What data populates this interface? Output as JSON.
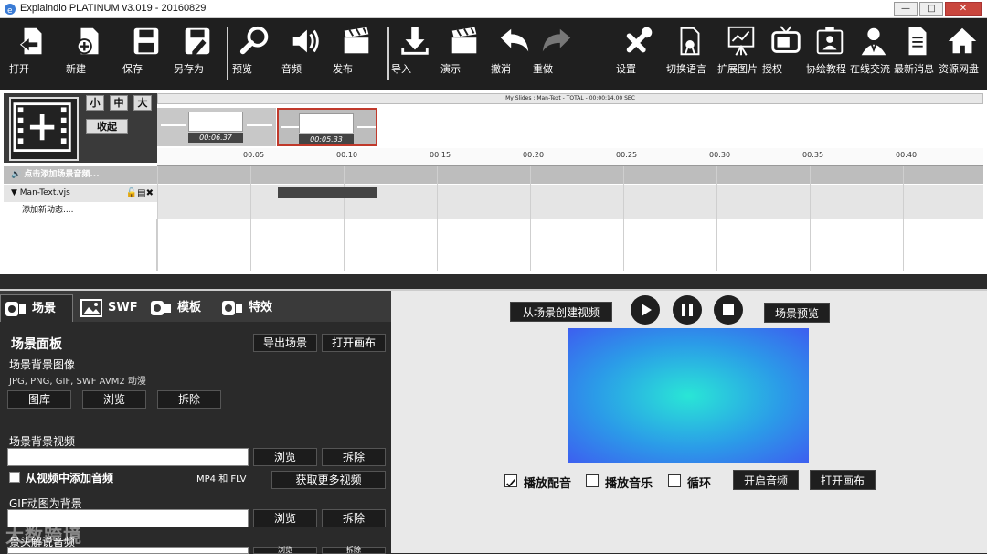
{
  "window": {
    "title": "Explaindio PLATINUM v3.019 - 20160829",
    "controls": [
      "—",
      "□",
      "✕"
    ]
  },
  "toolbar": {
    "items": [
      {
        "id": "open",
        "label": "打开",
        "icon": "open-icon"
      },
      {
        "id": "new",
        "label": "新建",
        "icon": "new-icon"
      },
      {
        "id": "save",
        "label": "保存",
        "icon": "save-icon"
      },
      {
        "id": "saveas",
        "label": "另存为",
        "icon": "save-as-icon"
      },
      {
        "id": "preview",
        "label": "预览",
        "icon": "magnifier-icon"
      },
      {
        "id": "audio",
        "label": "音频",
        "icon": "speaker-icon"
      },
      {
        "id": "publish",
        "label": "发布",
        "icon": "clapper-icon"
      },
      {
        "id": "import",
        "label": "导入",
        "icon": "download-icon"
      },
      {
        "id": "demo",
        "label": "演示",
        "icon": "clapper-icon"
      },
      {
        "id": "undo",
        "label": "撤消",
        "icon": "undo-icon"
      },
      {
        "id": "redo",
        "label": "重做",
        "icon": "redo-icon"
      },
      {
        "id": "settings",
        "label": "设置",
        "icon": "tools-icon"
      },
      {
        "id": "language",
        "label": "切换语言",
        "icon": "certificate-icon"
      },
      {
        "id": "extend",
        "label": "扩展图片",
        "icon": "chart-board-icon"
      },
      {
        "id": "license",
        "label": "授权",
        "icon": "tv-icon"
      },
      {
        "id": "tutorial",
        "label": "协绘教程",
        "icon": "id-card-icon"
      },
      {
        "id": "support",
        "label": "在线交流",
        "icon": "person-icon"
      },
      {
        "id": "news",
        "label": "最新消息",
        "icon": "document-icon"
      },
      {
        "id": "resources",
        "label": "资源网盘",
        "icon": "home-icon"
      }
    ]
  },
  "timeline": {
    "size_small": "小",
    "size_medium": "中",
    "size_large": "大",
    "collapse": "收起",
    "slides_info": "My Slides : Man-Text  -  TOTAL -  00:00:14.00 SEC",
    "scenes": [
      {
        "duration": "00:06.37",
        "selected": false
      },
      {
        "duration": "00:05.33",
        "selected": true
      }
    ],
    "ticks": [
      "00:05",
      "00:10",
      "00:15",
      "00:20",
      "00:25",
      "00:30",
      "00:35",
      "00:40"
    ],
    "audio_row": "点击添加场景音频...",
    "layer_name": "Man-Text.vjs",
    "add_animation": "添加新动态...."
  },
  "left_panel": {
    "tabs": [
      {
        "label": "场景",
        "icon": "scene-icon",
        "active": true
      },
      {
        "label": "SWF",
        "icon": "image-icon",
        "active": false
      },
      {
        "label": "模板",
        "icon": "template-icon",
        "active": false
      },
      {
        "label": "特效",
        "icon": "effects-icon",
        "active": false
      }
    ],
    "heading": "场景面板",
    "export_scene": "导出场景",
    "open_canvas": "打开画布",
    "bg_image_label": "场景背景图像",
    "bg_image_formats": "JPG, PNG, GIF, SWF AVM2 动漫",
    "gallery": "图库",
    "browse": "浏览",
    "remove": "拆除",
    "bg_video_label": "场景背景视频",
    "add_audio_from_video": "从视频中添加音频",
    "video_formats": "MP4 和 FLV",
    "get_more_videos": "获取更多视频",
    "gif_bg_label": "GIF动图为背景",
    "narration_label": "景头解说音频"
  },
  "watermark": "大数跨境",
  "right_panel": {
    "create_video": "从场景创建视频",
    "scene_preview": "场景预览",
    "play_voiceover": "播放配音",
    "play_music": "播放音乐",
    "loop": "循环",
    "open_audio": "开启音频",
    "open_canvas": "打开画布",
    "checks": {
      "voiceover": true,
      "music": false,
      "loop": false
    }
  },
  "colors": {
    "toolbar_bg": "#1f1f1f",
    "panel_bg": "#2a2a2a",
    "playhead": "#e74c3c",
    "selected_scene": "#c0392b"
  }
}
